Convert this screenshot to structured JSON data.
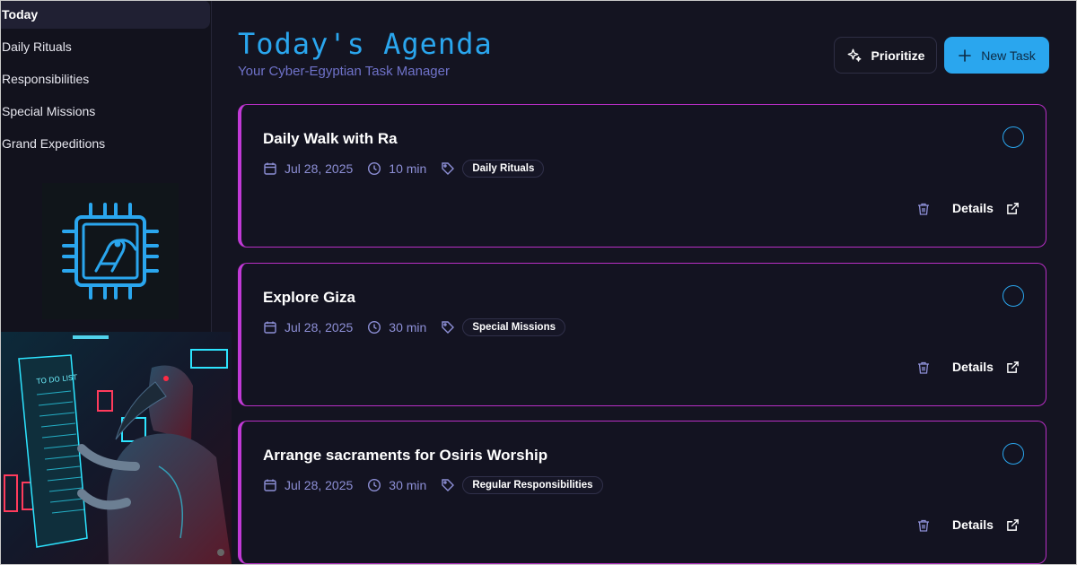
{
  "sidebar": {
    "items": [
      {
        "label": "Today",
        "active": true
      },
      {
        "label": "Daily Rituals",
        "active": false
      },
      {
        "label": "Responsibilities",
        "active": false
      },
      {
        "label": "Special Missions",
        "active": false
      },
      {
        "label": "Grand Expeditions",
        "active": false
      }
    ],
    "logo_icon": "cyber-ibis-chip-icon",
    "mascot_image": "thoth-robot-todo-list-illustration",
    "mascot_scroll_text": "TO DO LIST"
  },
  "header": {
    "title": "Today's Agenda",
    "subtitle": "Your Cyber-Egyptian Task Manager",
    "prioritize_label": "Prioritize",
    "new_task_label": "New Task"
  },
  "tasks": [
    {
      "title": "Daily Walk with Ra",
      "date": "Jul 28, 2025",
      "duration": "10 min",
      "tag": "Daily Rituals",
      "details_label": "Details"
    },
    {
      "title": "Explore Giza",
      "date": "Jul 28, 2025",
      "duration": "30 min",
      "tag": "Special Missions",
      "details_label": "Details"
    },
    {
      "title": "Arrange sacraments for Osiris Worship",
      "date": "Jul 28, 2025",
      "duration": "30 min",
      "tag": "Regular Responsibilities",
      "details_label": "Details"
    }
  ],
  "colors": {
    "accent": "#2aa6ee",
    "subtitle": "#6f72c9",
    "card_border": "#b82ec5",
    "background": "#141421"
  }
}
